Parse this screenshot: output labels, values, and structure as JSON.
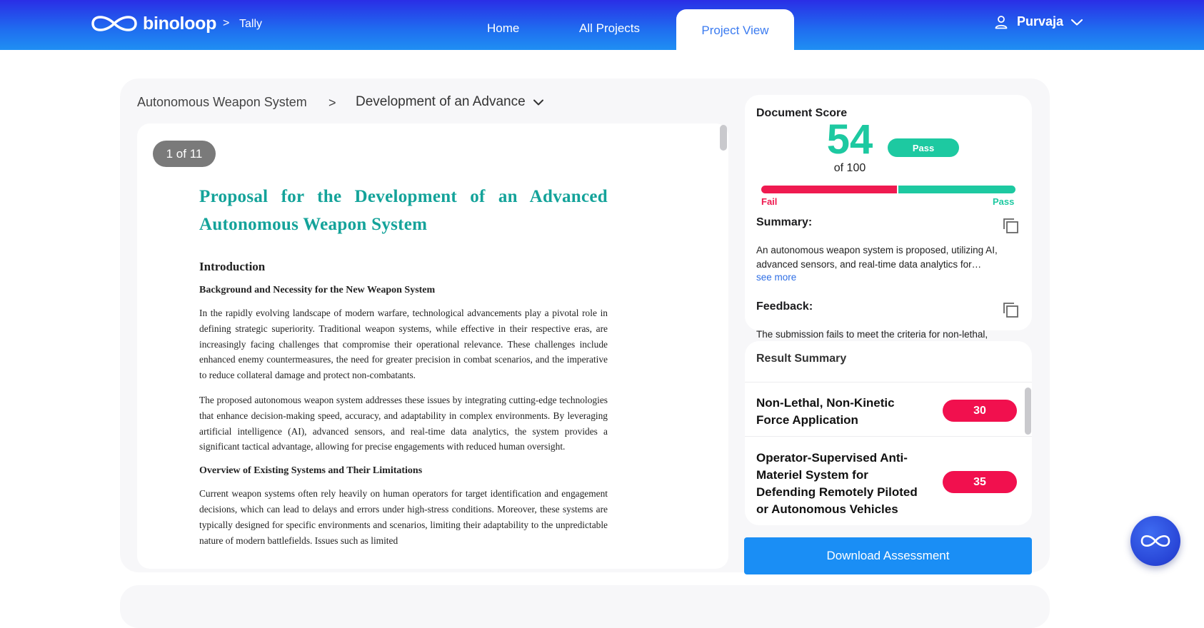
{
  "header": {
    "brand": "binoloop",
    "crumb_separator": ">",
    "app_name": "Tally",
    "nav": {
      "home": "Home",
      "all_projects": "All Projects",
      "project_view": "Project View"
    },
    "user": "Purvaja"
  },
  "breadcrumb": {
    "project": "Autonomous Weapon System",
    "separator": ">",
    "document": "Development of an Advance"
  },
  "viewer": {
    "page_indicator": "1 of 11",
    "doc": {
      "title": "Proposal for the Development of an Advanced Autonomous Weapon System",
      "section": "Introduction",
      "sub1": "Background and Necessity for the New Weapon System",
      "p1": "In the rapidly evolving landscape of modern warfare, technological advancements play a pivotal role in defining strategic superiority. Traditional weapon systems, while effective in their respective eras, are increasingly facing challenges that compromise their operational relevance. These challenges include enhanced enemy countermeasures, the need for greater precision in combat scenarios, and the imperative to reduce collateral damage and protect non-combatants.",
      "p2": "The proposed autonomous weapon system addresses these issues by integrating cutting-edge technologies that enhance decision-making speed, accuracy, and adaptability in complex environments. By leveraging artificial intelligence (AI), advanced sensors, and real-time data analytics, the system provides a significant tactical advantage, allowing for precise engagements with reduced human oversight.",
      "sub2": "Overview of Existing Systems and Their Limitations",
      "p3": "Current weapon systems often rely heavily on human operators for target identification and engagement decisions, which can lead to delays and errors under high-stress conditions. Moreover, these systems are typically designed for specific environments and scenarios, limiting their adaptability to the unpredictable nature of modern battlefields. Issues such as limited"
    }
  },
  "score": {
    "label": "Document Score",
    "value": "54",
    "out_of": "of 100",
    "status": "Pass",
    "fraction": 0.54,
    "fail_label": "Fail",
    "pass_label": "Pass",
    "summary_label": "Summary:",
    "summary_text": "An autonomous weapon system is proposed, utilizing AI, advanced sensors, and real-time data analytics for…",
    "see_more": "see more",
    "feedback_label": "Feedback:",
    "feedback_text": "The submission fails to meet the criteria for non-lethal,"
  },
  "results": {
    "title": "Result Summary",
    "items": [
      {
        "label": "Non-Lethal, Non-Kinetic Force Application",
        "score": "30"
      },
      {
        "label": "Operator-Supervised Anti-Materiel System for Defending Remotely Piloted or Autonomous Vehicles",
        "score": "35"
      }
    ]
  },
  "download_label": "Download Assessment",
  "colors": {
    "nav_gradient_top": "#2a2ee6",
    "nav_gradient_bottom": "#1f8ff3",
    "accent_teal": "#1dc9a1",
    "fail_red": "#ef1a50",
    "primary_blue": "#1a8ef5",
    "doc_title": "#14a39a"
  }
}
